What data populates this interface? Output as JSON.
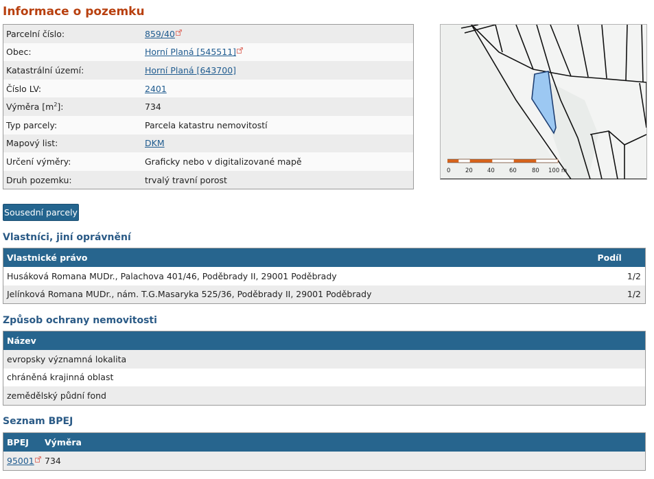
{
  "page": {
    "title": "Informace o pozemku"
  },
  "info": {
    "rows": [
      {
        "label": "Parcelní číslo:",
        "value": "859/40",
        "link": true,
        "external": true
      },
      {
        "label": "Obec:",
        "value": "Horní Planá [545511]",
        "link": true,
        "external": true
      },
      {
        "label": "Katastrální území:",
        "value": "Horní Planá [643700]",
        "link": true,
        "external": false
      },
      {
        "label": "Číslo LV:",
        "value": "2401",
        "link": true,
        "external": false
      },
      {
        "label": "Výměra [m",
        "label_sup": "2",
        "label_end": "]:",
        "value": "734",
        "link": false
      },
      {
        "label": "Typ parcely:",
        "value": "Parcela katastru nemovitostí",
        "link": false
      },
      {
        "label": "Mapový list:",
        "value": "DKM",
        "link": true,
        "external": false
      },
      {
        "label": "Určení výměry:",
        "value": "Graficky nebo v digitalizované mapě",
        "link": false
      },
      {
        "label": "Druh pozemku:",
        "value": "trvalý travní porost",
        "link": false
      }
    ]
  },
  "map": {
    "scale_labels": [
      "0",
      "20",
      "40",
      "60",
      "80",
      "100 m"
    ],
    "colors": {
      "parcel_fill": "#9cc8f2",
      "parcel_stroke": "#1e3f73",
      "scale_orange": "#d9651c"
    }
  },
  "buttons": {
    "neighbors": "Sousední parcely"
  },
  "owners": {
    "title": "Vlastníci, jiní oprávnění",
    "headers": {
      "name": "Vlastnické právo",
      "share": "Podíl"
    },
    "rows": [
      {
        "name": "Husáková Romana MUDr., Palachova 401/46, Poděbrady II, 29001 Poděbrady",
        "share": "1/2"
      },
      {
        "name": "Jelínková Romana MUDr., nám. T.G.Masaryka 525/36, Poděbrady II, 29001 Poděbrady",
        "share": "1/2"
      }
    ]
  },
  "protection": {
    "title": "Způsob ochrany nemovitosti",
    "headers": {
      "name": "Název"
    },
    "rows": [
      {
        "name": "evropsky významná lokalita"
      },
      {
        "name": "chráněná krajinná oblast"
      },
      {
        "name": "zemědělský půdní fond"
      }
    ]
  },
  "bpej": {
    "title": "Seznam BPEJ",
    "headers": {
      "code": "BPEJ",
      "area": "Výměra"
    },
    "rows": [
      {
        "code": "95001",
        "area": "734"
      }
    ]
  },
  "colors": {
    "title": "#b8400f",
    "header": "#27658e",
    "link": "#1f5b8f",
    "section": "#2a5a86"
  }
}
